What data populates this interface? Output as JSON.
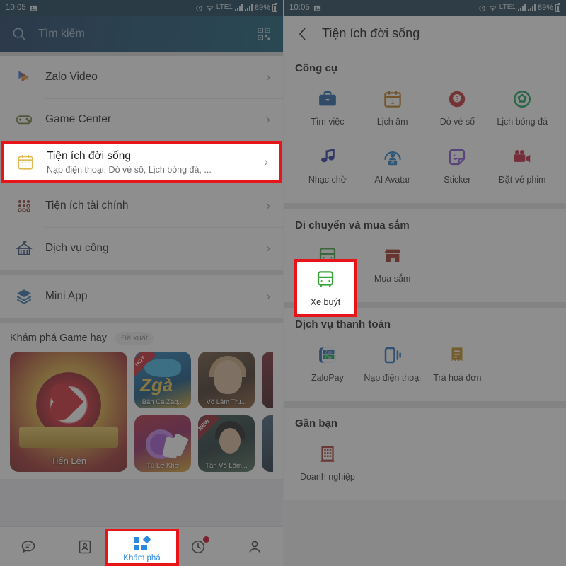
{
  "status_bar": {
    "time": "10:05",
    "battery": "89%",
    "icons": [
      "image-icon",
      "alarm-icon",
      "wifi-icon",
      "volte-icon",
      "signal-icon",
      "signal2-icon",
      "battery-icon"
    ]
  },
  "left_screen": {
    "search": {
      "placeholder": "Tìm kiếm",
      "search_icon": "search-icon",
      "qr_icon": "qr-scan-icon"
    },
    "menu_items": [
      {
        "label": "Zalo Video",
        "sub": "",
        "icon": "zalo-video-icon"
      },
      {
        "label": "Game Center",
        "sub": "",
        "icon": "gamepad-icon"
      },
      {
        "label": "Tiện ích đời sống",
        "sub": "Nạp điện thoại, Dò vé số, Lịch bóng đá, ...",
        "icon": "calendar-icon",
        "highlighted": true
      },
      {
        "label": "Tiện ích tài chính",
        "sub": "",
        "icon": "dots-grid-icon"
      },
      {
        "label": "Dịch vụ công",
        "sub": "",
        "icon": "government-icon"
      }
    ],
    "mini_app": {
      "label": "Mini App",
      "icon": "layers-icon"
    },
    "discover": {
      "title": "Khám phá Game hay",
      "tag": "Đề xuất",
      "featured": {
        "label": "Tiến Lên"
      },
      "cards": [
        {
          "label": "Bản Cá Zag...",
          "badge": "HOT"
        },
        {
          "label": "Võ Lâm Tru...",
          "badge": ""
        },
        {
          "label": "Tú Lơ Khơ",
          "badge": ""
        },
        {
          "label": "Tân Võ Lâm...",
          "badge": "NEW"
        }
      ]
    },
    "bottom_nav": [
      {
        "label": "",
        "icon": "chat-icon",
        "active": false
      },
      {
        "label": "",
        "icon": "contacts-icon",
        "active": false
      },
      {
        "label": "Khám phá",
        "icon": "discover-grid-icon",
        "active": true
      },
      {
        "label": "",
        "icon": "timeline-clock-icon",
        "active": false,
        "badge": true
      },
      {
        "label": "",
        "icon": "person-icon",
        "active": false
      }
    ]
  },
  "right_screen": {
    "header": {
      "title": "Tiện ích đời sống",
      "back_icon": "back-chevron-icon"
    },
    "sections": [
      {
        "title": "Công cụ",
        "items": [
          {
            "label": "Tìm việc",
            "icon": "briefcase-icon",
            "color": "#1f63a8"
          },
          {
            "label": "Lịch âm",
            "icon": "calendar-icon",
            "color": "#c07a1a"
          },
          {
            "label": "Dò vé số",
            "icon": "billiard-ball-icon",
            "color": "#c0282c"
          },
          {
            "label": "Lịch bóng đá",
            "icon": "soccer-ball-icon",
            "color": "#0e9e5a"
          },
          {
            "label": "Nhạc chờ",
            "icon": "music-note-icon",
            "color": "#1f2f9e"
          },
          {
            "label": "AI Avatar",
            "icon": "ai-avatar-icon",
            "color": "#1f7fc4"
          },
          {
            "label": "Sticker",
            "icon": "sticker-icon",
            "color": "#7a4fd0"
          },
          {
            "label": "Đặt vé phim",
            "icon": "movie-camera-icon",
            "color": "#c41e3a"
          }
        ]
      },
      {
        "title": "Di chuyển và mua sắm",
        "items": [
          {
            "label": "Xe buýt",
            "icon": "bus-icon",
            "color": "#3aa53a",
            "highlighted": true
          },
          {
            "label": "Mua sắm",
            "icon": "shop-icon",
            "color": "#9e2b20"
          }
        ]
      },
      {
        "title": "Dịch vụ thanh toán",
        "items": [
          {
            "label": "ZaloPay",
            "icon": "zalopay-icon",
            "color": "#1661b0"
          },
          {
            "label": "Nạp điện thoại",
            "icon": "topup-phone-icon",
            "color": "#1f6fc0"
          },
          {
            "label": "Trả hoá đơn",
            "icon": "invoice-icon",
            "color": "#c08a1a"
          }
        ]
      },
      {
        "title": "Gần bạn",
        "items": [
          {
            "label": "Doanh nghiệp",
            "icon": "building-icon",
            "color": "#a8352c"
          }
        ]
      }
    ]
  },
  "colors": {
    "highlight": "#e7141a",
    "accent": "#2b8ae0",
    "statusbar": "#123a52"
  }
}
